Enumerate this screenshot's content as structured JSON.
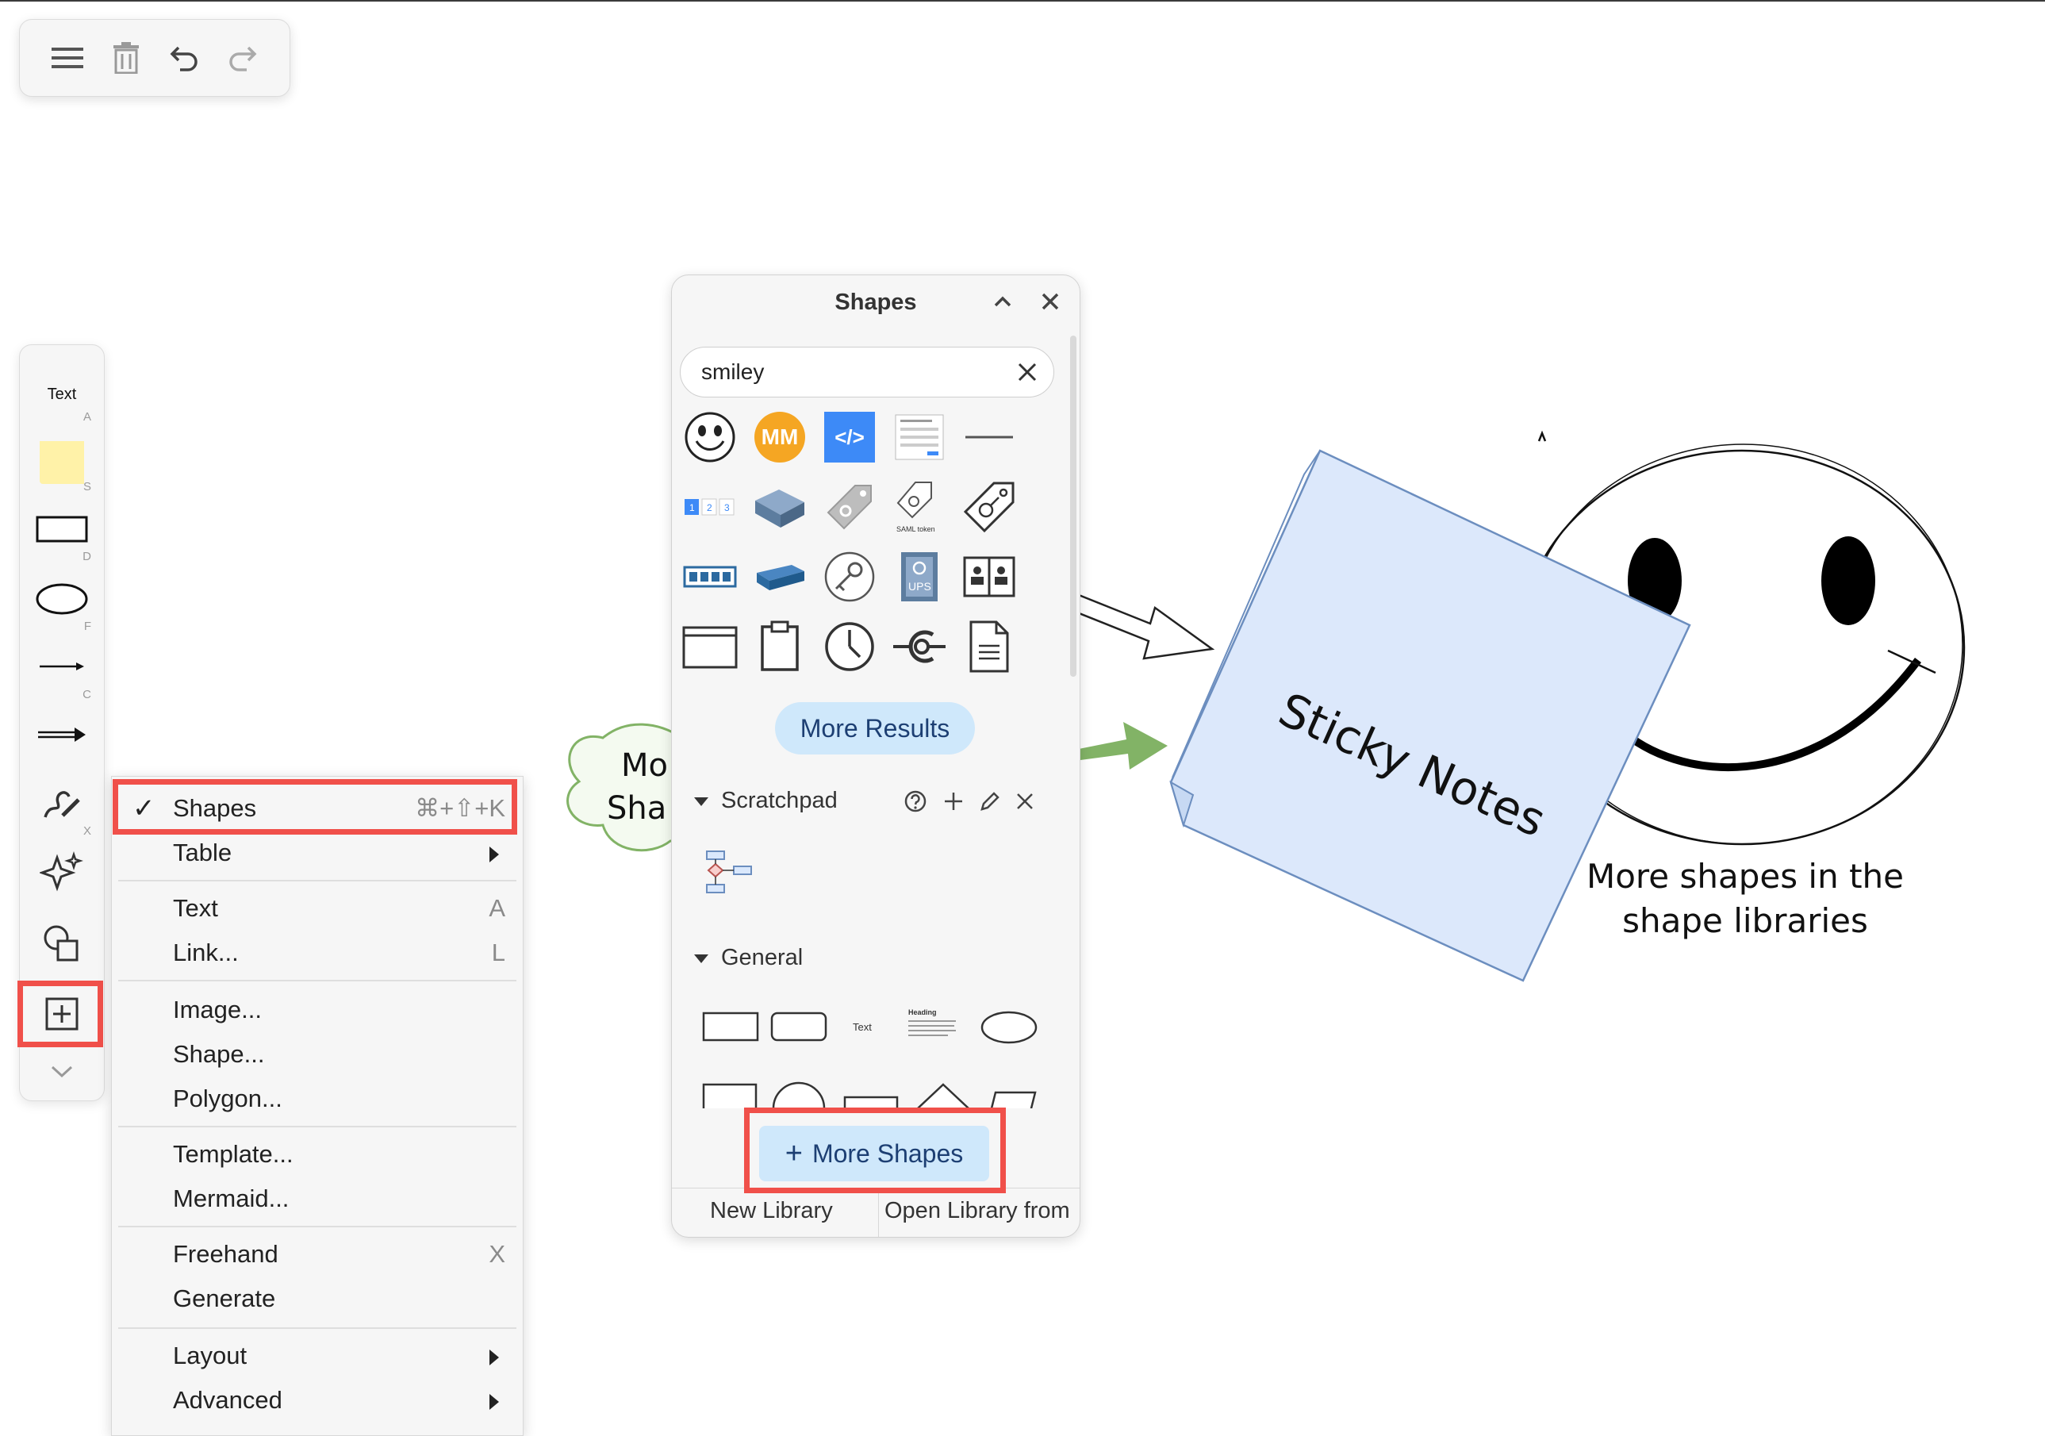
{
  "toolbar": {
    "icons": [
      "menu-icon",
      "delete-icon",
      "undo-icon",
      "redo-icon"
    ]
  },
  "left_toolbar": {
    "text_label": "Text",
    "text_key": "A",
    "sticky_key": "S",
    "rect_key": "D",
    "ellipse_key": "F",
    "line_key": "C",
    "freehand_key": "X",
    "icons": [
      "sticky-note-icon",
      "rectangle-icon",
      "ellipse-icon",
      "line-icon",
      "arrow-icon",
      "freehand-icon",
      "sparkle-icon",
      "shapes-icon",
      "insert-plus-icon",
      "chevron-down-icon"
    ]
  },
  "menu": {
    "items": [
      {
        "label": "Shapes",
        "shortcut": "⌘+⇧+K",
        "checked": true
      },
      {
        "label": "Table",
        "submenu": true
      },
      {
        "label": "Text",
        "shortcut": "A"
      },
      {
        "label": "Link...",
        "shortcut": "L"
      },
      {
        "label": "Image..."
      },
      {
        "label": "Shape..."
      },
      {
        "label": "Polygon..."
      },
      {
        "label": "Template..."
      },
      {
        "label": "Mermaid..."
      },
      {
        "label": "Freehand",
        "shortcut": "X"
      },
      {
        "label": "Generate"
      },
      {
        "label": "Layout",
        "submenu": true
      },
      {
        "label": "Advanced",
        "submenu": true
      }
    ],
    "check_mark": "✓"
  },
  "panel": {
    "title": "Shapes",
    "search_value": "smiley",
    "more_results": "More Results",
    "scratchpad": "Scratchpad",
    "general": "General",
    "general_text": "Text",
    "general_heading": "Heading",
    "more_shapes_plus": "+",
    "more_shapes": "More Shapes",
    "new_library": "New Library",
    "open_library": "Open Library from",
    "saml_token": "SAML token",
    "ups": "UPS",
    "mm": "MM",
    "code": "</>",
    "pages": [
      "1",
      "2",
      "3"
    ]
  },
  "canvas": {
    "sticky_text": "Sticky Notes",
    "cloud_text_1": "Mo",
    "cloud_text_2": "Sha",
    "caption_line1": "More shapes in the",
    "caption_line2": "shape libraries"
  },
  "colors": {
    "highlight": "#f0504a",
    "sticky": "#dce8fb",
    "sticky_border": "#6c8ebf",
    "green_arrow": "#82b366",
    "button_bg": "#cfe8fb",
    "accent_blue": "#3d8af7",
    "mm_orange": "#f5a623"
  }
}
